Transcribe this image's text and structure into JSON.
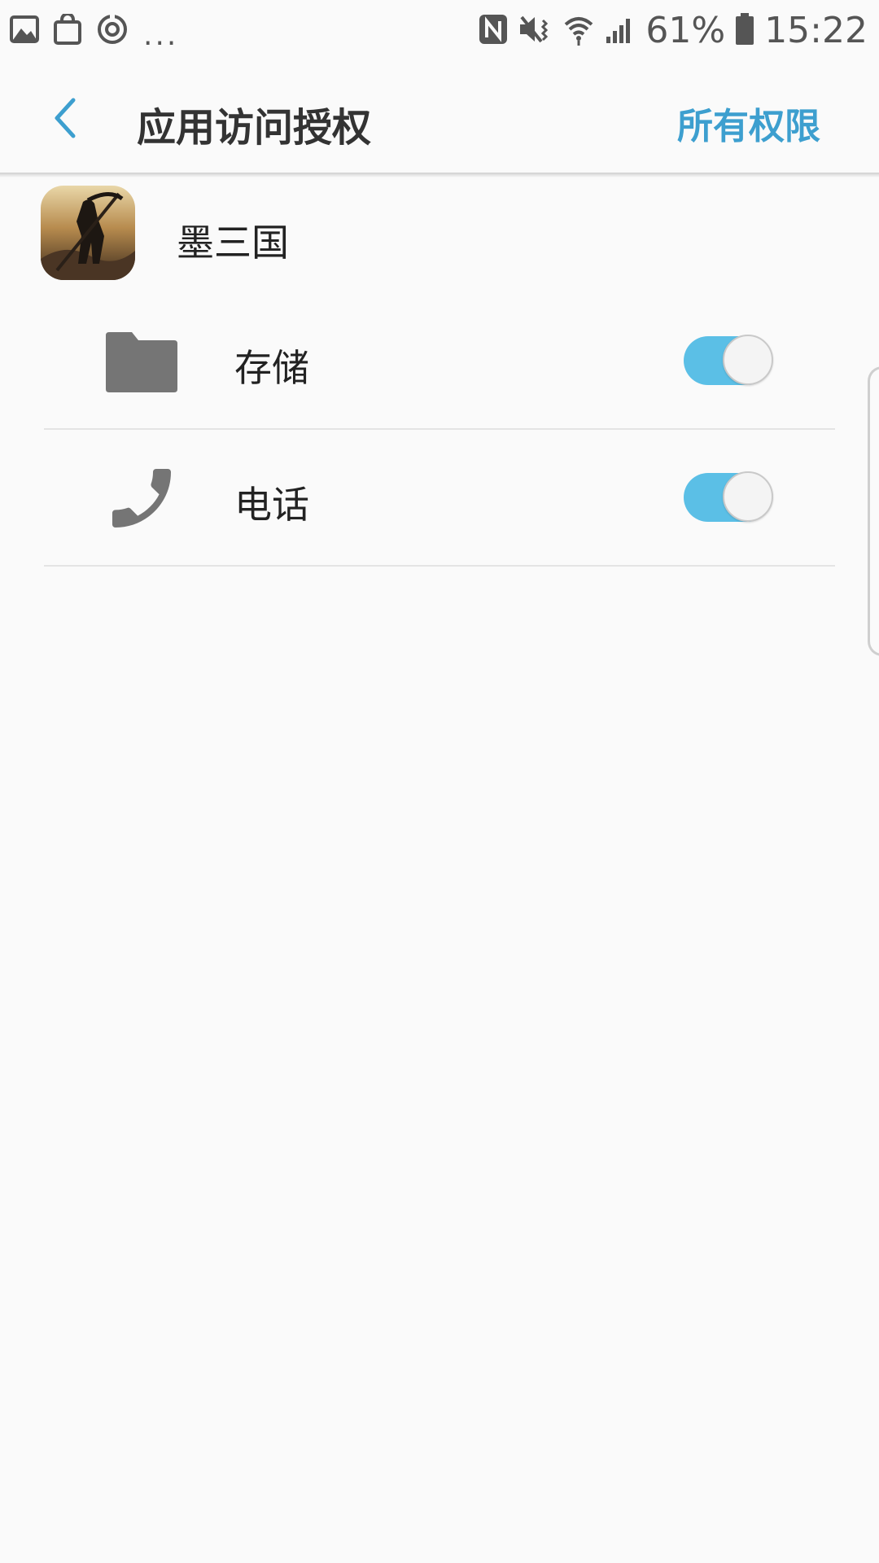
{
  "status_bar": {
    "left_icons": [
      "gallery-icon",
      "shopping-bag-icon",
      "sync-icon"
    ],
    "more": "...",
    "right_icons": [
      "nfc-icon",
      "mute-vibrate-icon",
      "wifi-icon",
      "signal-icon"
    ],
    "battery": "61%",
    "time": "15:22"
  },
  "header": {
    "back_icon": "chevron-left-icon",
    "title": "应用访问授权",
    "action_label": "所有权限",
    "accent_color": "#3d9fcf"
  },
  "app": {
    "name": "墨三国",
    "icon": "game-app-icon"
  },
  "permissions": [
    {
      "label": "存储",
      "icon": "folder-icon",
      "enabled": true
    },
    {
      "label": "电话",
      "icon": "phone-icon",
      "enabled": true
    }
  ],
  "toggle_on_color": "#5bbfe6"
}
